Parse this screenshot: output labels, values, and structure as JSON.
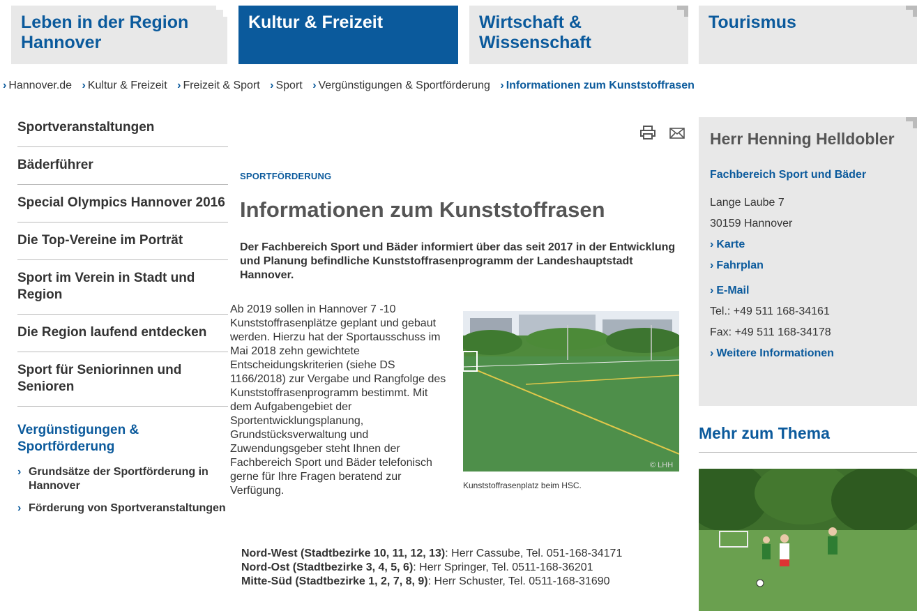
{
  "topnav": {
    "items": [
      {
        "label_line1": "Leben in der Region",
        "label_line2": "Hannover"
      },
      {
        "label_line1": "Kultur & Freizeit",
        "label_line2": ""
      },
      {
        "label_line1": "Wirtschaft &",
        "label_line2": "Wissenschaft"
      },
      {
        "label_line1": "Tourismus",
        "label_line2": ""
      }
    ],
    "active_color": "#0b5a9c"
  },
  "breadcrumb": [
    "Hannover.de",
    "Kultur & Freizeit",
    "Freizeit & Sport",
    "Sport",
    "Vergünstigungen & Sportförderung",
    "Informationen zum Kunststoffrasen"
  ],
  "sidebar": {
    "items": [
      {
        "label": "Sportveranstaltungen"
      },
      {
        "label": "Bäderführer"
      },
      {
        "label": "Special Olympics Hannover 2016"
      },
      {
        "label": "Die Top-Vereine im Porträt"
      },
      {
        "label": "Sport im Verein in Stadt und Region"
      },
      {
        "label": "Die Region laufend entdecken"
      },
      {
        "label": "Sport für Seniorinnen und Senioren"
      }
    ],
    "active_label": "Vergünstigungen & Sportförderung",
    "sub_items": [
      "Grundsätze der Sportförderung in Hannover",
      "Förderung von Sportveranstaltungen"
    ]
  },
  "main": {
    "kicker": "SPORTFÖRDERUNG",
    "headline": "Informationen zum Kunststoffrasen",
    "lead": "Der Fachbereich Sport und Bäder informiert über das seit 2017 in der Entwicklung und Planung befindliche Kunststoffrasenprogramm der Landeshauptstadt Hannover.",
    "body": "Ab 2019 sollen in Hannover 7 -10 Kunststoffrasenplätze geplant und gebaut werden. Hierzu hat der Sportausschuss im Mai 2018 zehn gewichtete Entscheidungskriterien (siehe DS 1166/2018) zur Vergabe und Rangfolge des Kunststoffrasenprogramm bestimmt. Mit dem Aufgabengebiet der Sportentwicklungsplanung, Grundstücksverwaltung und Zuwendungsgeber steht Ihnen der Fachbereich Sport und Bäder telefonisch gerne für Ihre Fragen beratend zur Verfügung.",
    "photo_credit": "© LHH",
    "caption": "Kunststoffrasenplatz beim HSC.",
    "contacts": [
      {
        "region": "Nord-West (Stadtbezirke 10, 11, 12, 13)",
        "text": ": Herr Cassube, Tel. 051-168-34171"
      },
      {
        "region": "Nord-Ost (Stadtbezirke 3, 4, 5, 6)",
        "text": ": Herr Springer, Tel. 0511-168-36201"
      },
      {
        "region": "Mitte-Süd (Stadtbezirke 1, 2, 7, 8, 9)",
        "text": ": Herr Schuster, Tel. 0511-168-31690"
      }
    ]
  },
  "contact_box": {
    "name": "Herr Henning Helldobler",
    "department": "Fachbereich Sport und Bäder",
    "street": "Lange Laube 7",
    "city": "30159 Hannover",
    "link_map": "Karte",
    "link_timetable": "Fahrplan",
    "link_email": "E-Mail",
    "phone": "Tel.: +49 511 168-34161",
    "fax": "Fax: +49 511 168-34178",
    "link_more": "Weitere Informationen"
  },
  "more_topic": {
    "title": "Mehr zum Thema"
  },
  "icons": [
    "print-icon",
    "mail-icon",
    "chevron-right-icon"
  ]
}
